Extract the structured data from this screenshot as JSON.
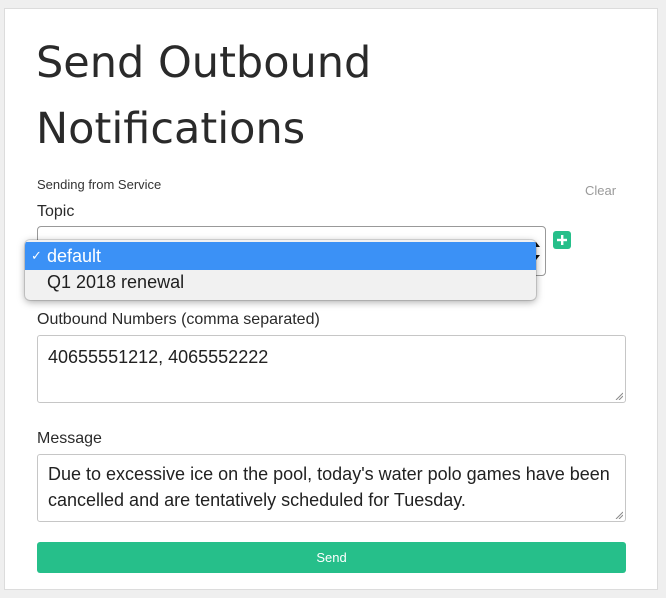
{
  "page": {
    "title": "Send Outbound Notifications",
    "service_label": "Sending from Service",
    "clear_label": "Clear"
  },
  "topic": {
    "label": "Topic",
    "options": [
      {
        "label": "default",
        "selected": true
      },
      {
        "label": "Q1 2018 renewal",
        "selected": false
      }
    ],
    "check_glyph": "✓",
    "add_icon": "plus-icon"
  },
  "numbers": {
    "label": "Outbound Numbers (comma separated)",
    "value": "40655551212, 4065552222"
  },
  "message": {
    "label": "Message",
    "value": "Due to excessive ice on the pool, today's water polo games have been cancelled and are tentatively scheduled for Tuesday."
  },
  "send_button": {
    "label": "Send"
  },
  "colors": {
    "accent": "#26bf8a",
    "dropdown_highlight": "#3b91f6",
    "background": "#efefef"
  }
}
